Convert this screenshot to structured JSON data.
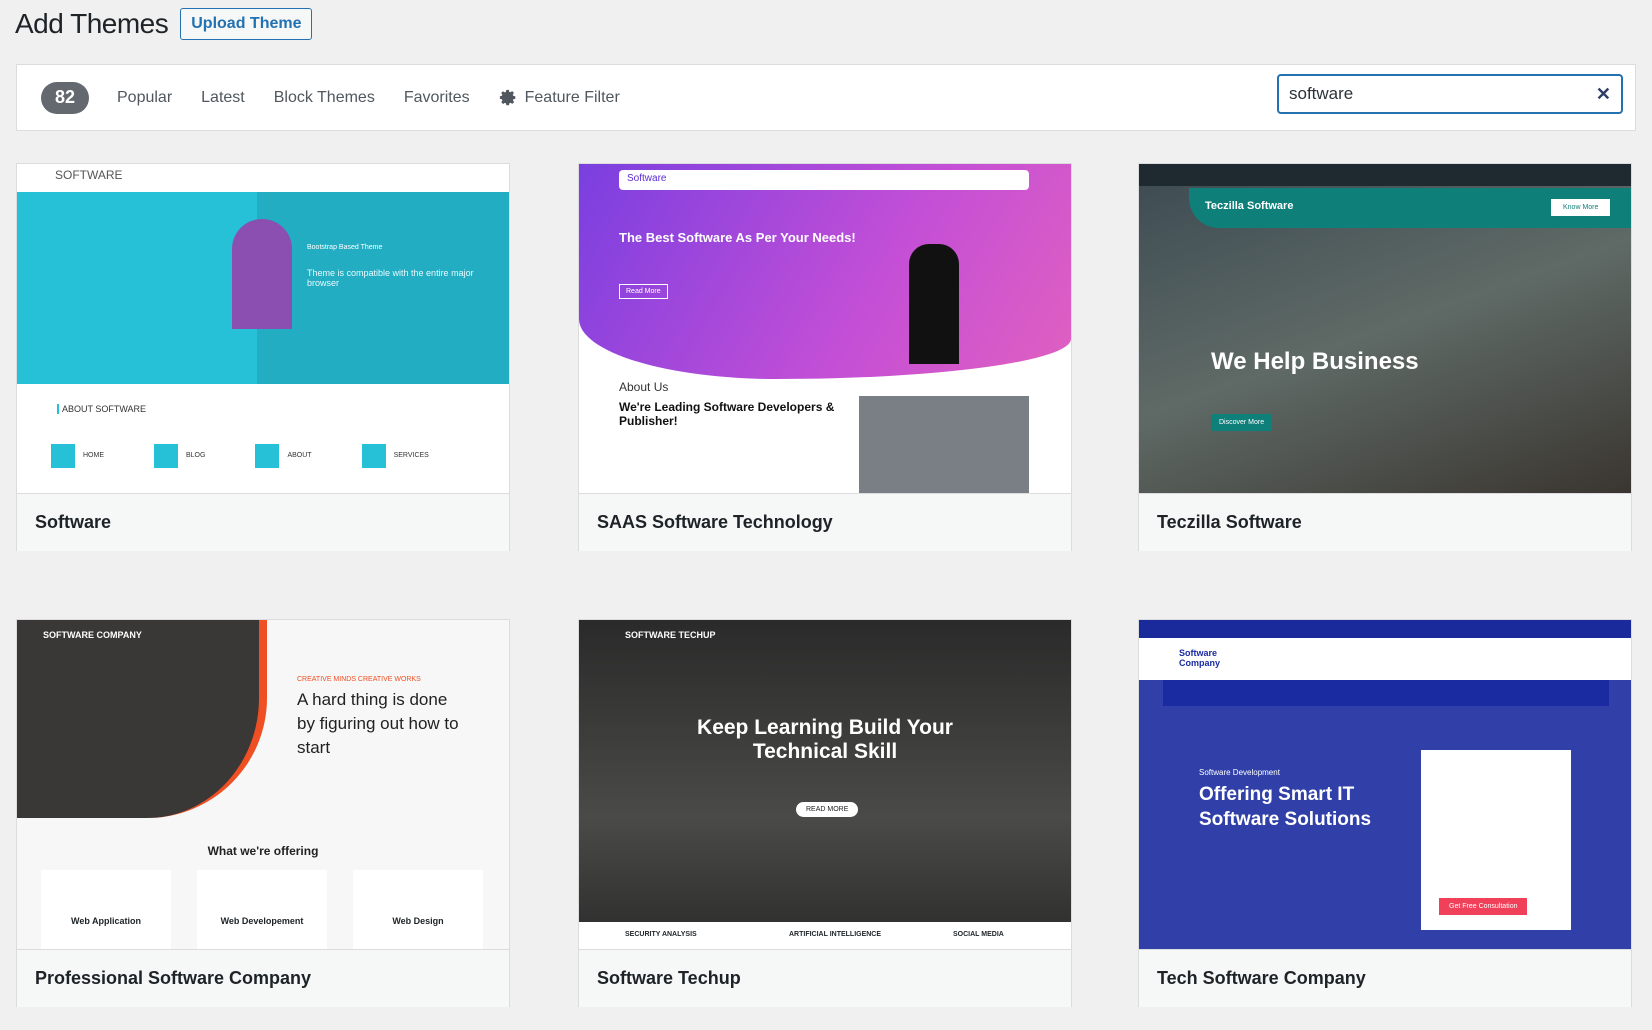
{
  "header": {
    "title": "Add Themes",
    "upload_label": "Upload Theme"
  },
  "filter": {
    "count": "82",
    "tabs": [
      "Popular",
      "Latest",
      "Block Themes",
      "Favorites"
    ],
    "feature_filter": "Feature Filter",
    "search_value": "software",
    "search_icon": "close-icon"
  },
  "themes": [
    {
      "name": "Software",
      "preview": {
        "logo": "SOFTWARE",
        "tag": "Bootstrap Based Theme",
        "text": "Theme is compatible with the entire major browser",
        "section": "ABOUT SOFTWARE",
        "items": [
          "HOME",
          "BLOG",
          "ABOUT",
          "SERVICES"
        ],
        "color": "#26c1d6"
      }
    },
    {
      "name": "SAAS Software Technology",
      "preview": {
        "logo": "Software",
        "headline": "The Best Software As Per Your Needs!",
        "btn": "Read More",
        "about": "About Us",
        "sub": "We're Leading Software Developers & Publisher!",
        "color": "#a74bd8"
      }
    },
    {
      "name": "Teczilla Software",
      "preview": {
        "logo": "Teczilla Software",
        "headline": "We Help Business",
        "btn": "Know More",
        "cta": "Discover More",
        "color": "#0f6e6e"
      }
    },
    {
      "name": "Professional Software Company",
      "preview": {
        "logo": "SOFTWARE COMPANY",
        "kicker": "CREATIVE MINDS CREATIVE WORKS",
        "headline": "A hard thing is done by figuring out how to start",
        "section": "What we're offering",
        "items": [
          "Web Application",
          "Web Developement",
          "Web Design"
        ],
        "color": "#f04e23"
      }
    },
    {
      "name": "Software Techup",
      "preview": {
        "logo": "SOFTWARE TECHUP",
        "headline": "Keep Learning Build Your Technical Skill",
        "btn": "READ MORE",
        "items": [
          "SECURITY ANALYSIS",
          "ARTIFICIAL INTELLIGENCE",
          "SOCIAL MEDIA"
        ],
        "color": "#2b2b2b"
      }
    },
    {
      "name": "Tech Software Company",
      "preview": {
        "logo": "Software Company",
        "kicker": "Software Development",
        "headline": "Offering Smart IT Software Solutions",
        "btn": "Get Free Consultation",
        "color": "#1a2aa0"
      }
    }
  ]
}
